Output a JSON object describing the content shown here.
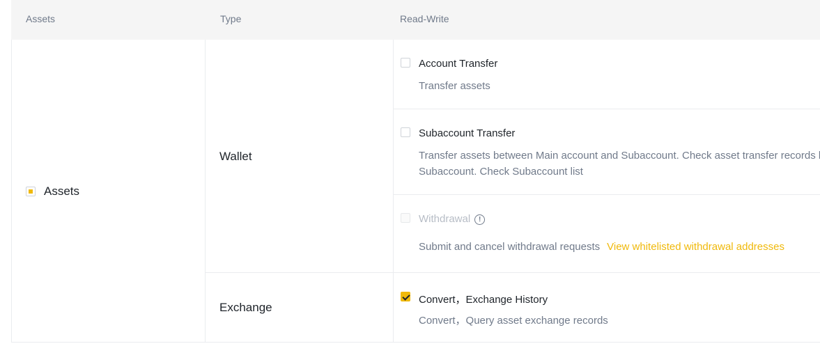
{
  "header": {
    "assets": "Assets",
    "type": "Type",
    "read_write": "Read-Write"
  },
  "group": {
    "label": "Assets",
    "state": "partial"
  },
  "types": {
    "wallet": "Wallet",
    "exchange": "Exchange"
  },
  "permissions": {
    "account_transfer": {
      "title": "Account Transfer",
      "desc": "Transfer assets",
      "checked": false
    },
    "subaccount_transfer": {
      "title": "Subaccount Transfer",
      "desc_line1": "Transfer assets between Main account and Subaccount. Check asset transfer records between Main account and",
      "desc_line2": "Subaccount. Check Subaccount list",
      "checked": false
    },
    "withdrawal": {
      "title": "Withdrawal",
      "desc": "Submit and cancel withdrawal requests",
      "link": "View whitelisted withdrawal addresses",
      "checked": false,
      "disabled": true
    },
    "convert": {
      "title": "Convert，Exchange History",
      "desc": "Convert，Query asset exchange records",
      "checked": true
    }
  },
  "colors": {
    "accent": "#f0b90b",
    "header_bg": "#f5f5f5",
    "border": "#eaecef",
    "muted_text": "#707a8a"
  },
  "icons": {
    "withdrawal_info": "info-circle-icon"
  }
}
